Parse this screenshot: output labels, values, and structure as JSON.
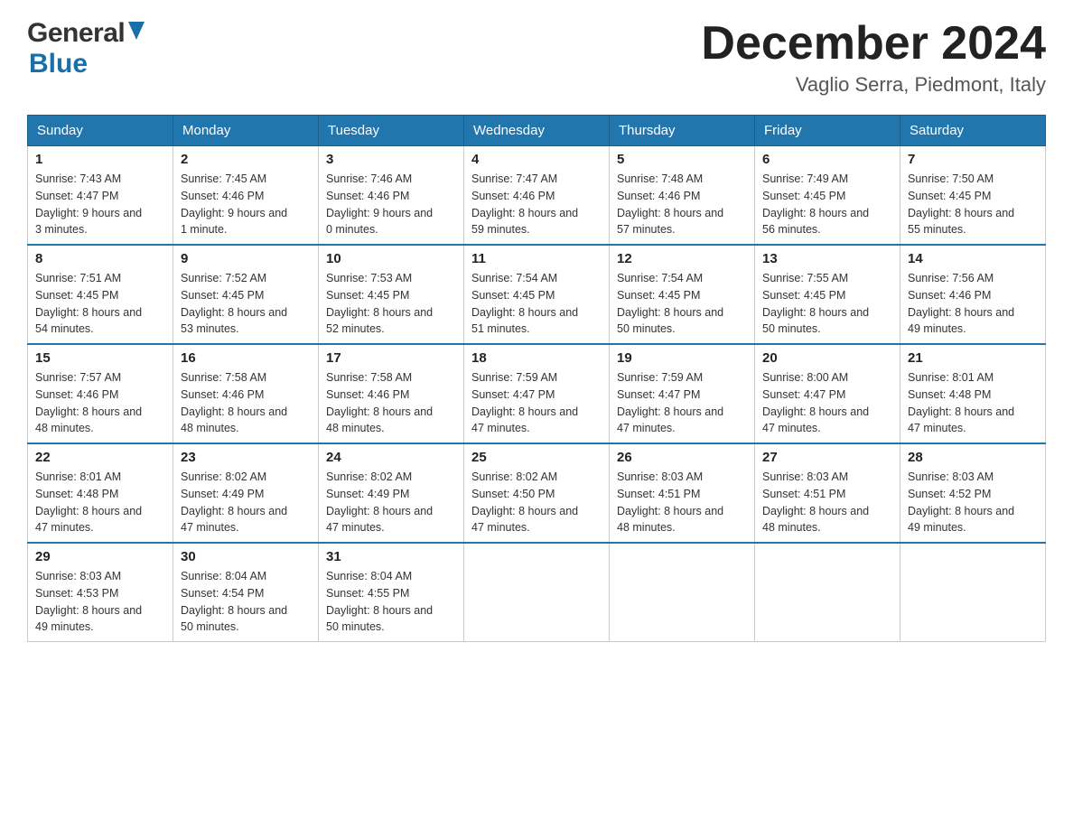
{
  "header": {
    "logo_general": "General",
    "logo_blue": "Blue",
    "month_title": "December 2024",
    "location": "Vaglio Serra, Piedmont, Italy"
  },
  "calendar": {
    "days_of_week": [
      "Sunday",
      "Monday",
      "Tuesday",
      "Wednesday",
      "Thursday",
      "Friday",
      "Saturday"
    ],
    "weeks": [
      [
        {
          "day": "1",
          "sunrise": "7:43 AM",
          "sunset": "4:47 PM",
          "daylight": "9 hours and 3 minutes."
        },
        {
          "day": "2",
          "sunrise": "7:45 AM",
          "sunset": "4:46 PM",
          "daylight": "9 hours and 1 minute."
        },
        {
          "day": "3",
          "sunrise": "7:46 AM",
          "sunset": "4:46 PM",
          "daylight": "9 hours and 0 minutes."
        },
        {
          "day": "4",
          "sunrise": "7:47 AM",
          "sunset": "4:46 PM",
          "daylight": "8 hours and 59 minutes."
        },
        {
          "day": "5",
          "sunrise": "7:48 AM",
          "sunset": "4:46 PM",
          "daylight": "8 hours and 57 minutes."
        },
        {
          "day": "6",
          "sunrise": "7:49 AM",
          "sunset": "4:45 PM",
          "daylight": "8 hours and 56 minutes."
        },
        {
          "day": "7",
          "sunrise": "7:50 AM",
          "sunset": "4:45 PM",
          "daylight": "8 hours and 55 minutes."
        }
      ],
      [
        {
          "day": "8",
          "sunrise": "7:51 AM",
          "sunset": "4:45 PM",
          "daylight": "8 hours and 54 minutes."
        },
        {
          "day": "9",
          "sunrise": "7:52 AM",
          "sunset": "4:45 PM",
          "daylight": "8 hours and 53 minutes."
        },
        {
          "day": "10",
          "sunrise": "7:53 AM",
          "sunset": "4:45 PM",
          "daylight": "8 hours and 52 minutes."
        },
        {
          "day": "11",
          "sunrise": "7:54 AM",
          "sunset": "4:45 PM",
          "daylight": "8 hours and 51 minutes."
        },
        {
          "day": "12",
          "sunrise": "7:54 AM",
          "sunset": "4:45 PM",
          "daylight": "8 hours and 50 minutes."
        },
        {
          "day": "13",
          "sunrise": "7:55 AM",
          "sunset": "4:45 PM",
          "daylight": "8 hours and 50 minutes."
        },
        {
          "day": "14",
          "sunrise": "7:56 AM",
          "sunset": "4:46 PM",
          "daylight": "8 hours and 49 minutes."
        }
      ],
      [
        {
          "day": "15",
          "sunrise": "7:57 AM",
          "sunset": "4:46 PM",
          "daylight": "8 hours and 48 minutes."
        },
        {
          "day": "16",
          "sunrise": "7:58 AM",
          "sunset": "4:46 PM",
          "daylight": "8 hours and 48 minutes."
        },
        {
          "day": "17",
          "sunrise": "7:58 AM",
          "sunset": "4:46 PM",
          "daylight": "8 hours and 48 minutes."
        },
        {
          "day": "18",
          "sunrise": "7:59 AM",
          "sunset": "4:47 PM",
          "daylight": "8 hours and 47 minutes."
        },
        {
          "day": "19",
          "sunrise": "7:59 AM",
          "sunset": "4:47 PM",
          "daylight": "8 hours and 47 minutes."
        },
        {
          "day": "20",
          "sunrise": "8:00 AM",
          "sunset": "4:47 PM",
          "daylight": "8 hours and 47 minutes."
        },
        {
          "day": "21",
          "sunrise": "8:01 AM",
          "sunset": "4:48 PM",
          "daylight": "8 hours and 47 minutes."
        }
      ],
      [
        {
          "day": "22",
          "sunrise": "8:01 AM",
          "sunset": "4:48 PM",
          "daylight": "8 hours and 47 minutes."
        },
        {
          "day": "23",
          "sunrise": "8:02 AM",
          "sunset": "4:49 PM",
          "daylight": "8 hours and 47 minutes."
        },
        {
          "day": "24",
          "sunrise": "8:02 AM",
          "sunset": "4:49 PM",
          "daylight": "8 hours and 47 minutes."
        },
        {
          "day": "25",
          "sunrise": "8:02 AM",
          "sunset": "4:50 PM",
          "daylight": "8 hours and 47 minutes."
        },
        {
          "day": "26",
          "sunrise": "8:03 AM",
          "sunset": "4:51 PM",
          "daylight": "8 hours and 48 minutes."
        },
        {
          "day": "27",
          "sunrise": "8:03 AM",
          "sunset": "4:51 PM",
          "daylight": "8 hours and 48 minutes."
        },
        {
          "day": "28",
          "sunrise": "8:03 AM",
          "sunset": "4:52 PM",
          "daylight": "8 hours and 49 minutes."
        }
      ],
      [
        {
          "day": "29",
          "sunrise": "8:03 AM",
          "sunset": "4:53 PM",
          "daylight": "8 hours and 49 minutes."
        },
        {
          "day": "30",
          "sunrise": "8:04 AM",
          "sunset": "4:54 PM",
          "daylight": "8 hours and 50 minutes."
        },
        {
          "day": "31",
          "sunrise": "8:04 AM",
          "sunset": "4:55 PM",
          "daylight": "8 hours and 50 minutes."
        },
        null,
        null,
        null,
        null
      ]
    ]
  },
  "labels": {
    "sunrise": "Sunrise:",
    "sunset": "Sunset:",
    "daylight": "Daylight:"
  }
}
